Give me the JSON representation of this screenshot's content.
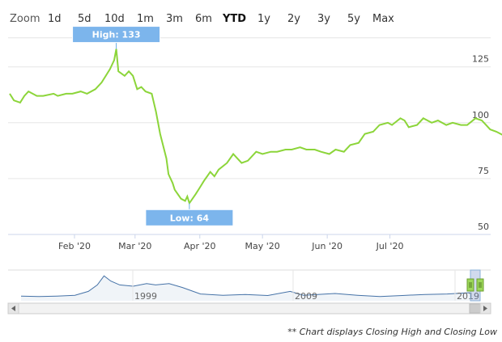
{
  "zoom": {
    "label": "Zoom",
    "buttons": [
      "1d",
      "5d",
      "10d",
      "1m",
      "3m",
      "6m",
      "YTD",
      "1y",
      "2y",
      "3y",
      "5y",
      "Max"
    ],
    "active": "YTD"
  },
  "chart_data": {
    "type": "line",
    "y_ticks": [
      50,
      75,
      100,
      125
    ],
    "ylim": [
      50,
      139
    ],
    "x_ticks": [
      "Feb '20",
      "Mar '20",
      "Apr '20",
      "May '20",
      "Jun '20",
      "Jul '20"
    ],
    "series": [
      {
        "color": "#8cd53a",
        "points": [
          [
            "Jan 1",
            113
          ],
          [
            "Jan 3",
            110
          ],
          [
            "Jan 6",
            109
          ],
          [
            "Jan 8",
            112
          ],
          [
            "Jan 10",
            114
          ],
          [
            "Jan 14",
            112
          ],
          [
            "Jan 17",
            112
          ],
          [
            "Jan 22",
            113
          ],
          [
            "Jan 24",
            112
          ],
          [
            "Jan 28",
            113
          ],
          [
            "Jan 31",
            113
          ],
          [
            "Feb 4",
            114
          ],
          [
            "Feb 7",
            113
          ],
          [
            "Feb 11",
            115
          ],
          [
            "Feb 14",
            118
          ],
          [
            "Feb 18",
            124
          ],
          [
            "Feb 20",
            128
          ],
          [
            "Feb 21",
            133
          ],
          [
            "Feb 22",
            123
          ],
          [
            "Feb 25",
            121
          ],
          [
            "Feb 27",
            123
          ],
          [
            "Feb 29",
            121
          ],
          [
            "Mar 2",
            115
          ],
          [
            "Mar 4",
            116
          ],
          [
            "Mar 6",
            114
          ],
          [
            "Mar 9",
            113
          ],
          [
            "Mar 11",
            105
          ],
          [
            "Mar 13",
            95
          ],
          [
            "Mar 16",
            84
          ],
          [
            "Mar 17",
            77
          ],
          [
            "Mar 19",
            73
          ],
          [
            "Mar 20",
            70
          ],
          [
            "Mar 23",
            66
          ],
          [
            "Mar 25",
            65
          ],
          [
            "Mar 26",
            67
          ],
          [
            "Mar 27",
            64
          ],
          [
            "Mar 30",
            68
          ],
          [
            "Apr 1",
            71
          ],
          [
            "Apr 3",
            74
          ],
          [
            "Apr 6",
            78
          ],
          [
            "Apr 8",
            76
          ],
          [
            "Apr 10",
            79
          ],
          [
            "Apr 14",
            82
          ],
          [
            "Apr 17",
            86
          ],
          [
            "Apr 21",
            82
          ],
          [
            "Apr 24",
            83
          ],
          [
            "Apr 28",
            87
          ],
          [
            "May 1",
            86
          ],
          [
            "May 5",
            87
          ],
          [
            "May 8",
            87
          ],
          [
            "May 12",
            88
          ],
          [
            "May 15",
            88
          ],
          [
            "May 19",
            89
          ],
          [
            "May 22",
            88
          ],
          [
            "May 26",
            88
          ],
          [
            "May 29",
            87
          ],
          [
            "Jun 2",
            86
          ],
          [
            "Jun 5",
            88
          ],
          [
            "Jun 9",
            87
          ],
          [
            "Jun 12",
            90
          ],
          [
            "Jun 16",
            91
          ],
          [
            "Jun 19",
            95
          ],
          [
            "Jun 23",
            96
          ],
          [
            "Jun 26",
            99
          ],
          [
            "Jun 30",
            100
          ],
          [
            "Jul 2",
            99
          ],
          [
            "Jul 6",
            102
          ],
          [
            "Jul 8",
            101
          ],
          [
            "Jul 10",
            98
          ],
          [
            "Jul 14",
            99
          ],
          [
            "Jul 17",
            102
          ],
          [
            "Jul 21",
            100
          ],
          [
            "Jul 24",
            101
          ],
          [
            "Jul 28",
            99
          ],
          [
            "Jul 31",
            100
          ],
          [
            "Aug 4",
            99
          ],
          [
            "Aug 7",
            99
          ],
          [
            "Aug 11",
            102
          ],
          [
            "Aug 14",
            101
          ],
          [
            "Aug 18",
            97
          ],
          [
            "Aug 21",
            96
          ],
          [
            "Aug 25",
            94
          ],
          [
            "Aug 28",
            93
          ],
          [
            "Sep 1",
            94
          ]
        ]
      }
    ],
    "annotations": {
      "high": {
        "label": "High: 133",
        "x": "Feb 21",
        "value": 133
      },
      "low": {
        "label": "Low: 64",
        "x": "Mar 27",
        "value": 64
      }
    },
    "navigator": {
      "labels": [
        "1999",
        "2009",
        "2019"
      ]
    }
  },
  "footnote": "** Chart displays Closing High and Closing Low"
}
